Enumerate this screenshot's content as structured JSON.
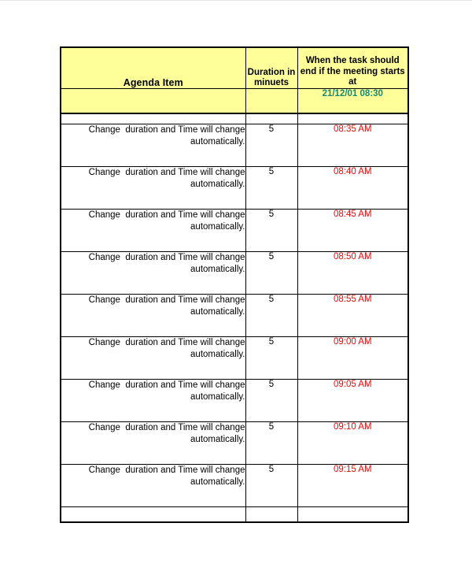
{
  "document": {
    "type": "meeting-agenda-table",
    "background_color": "#ffffff"
  },
  "table": {
    "header_background": "#ffff99",
    "border_color": "#000000",
    "columns": [
      {
        "key": "agenda_item",
        "label": "Agenda Item"
      },
      {
        "key": "duration",
        "label": "Duration\nin minuets"
      },
      {
        "key": "end_time",
        "label": "When the task should\nend if the meeting\nstarts at"
      }
    ],
    "start_datetime": {
      "value": "21/12/01  08:30",
      "color": "#138a72"
    },
    "time_color": "#ff0000",
    "rows": [
      {
        "agenda_item": "Change  duration and Time will change automatically.",
        "duration": "5",
        "end_time": "08:35 AM"
      },
      {
        "agenda_item": "Change  duration and Time will change automatically.",
        "duration": "5",
        "end_time": "08:40 AM"
      },
      {
        "agenda_item": "Change  duration and Time will change automatically.",
        "duration": "5",
        "end_time": "08:45 AM"
      },
      {
        "agenda_item": "Change  duration and Time will change automatically.",
        "duration": "5",
        "end_time": "08:50 AM"
      },
      {
        "agenda_item": "Change  duration and Time will change automatically.",
        "duration": "5",
        "end_time": "08:55 AM"
      },
      {
        "agenda_item": "Change  duration and Time will change automatically.",
        "duration": "5",
        "end_time": "09:00 AM"
      },
      {
        "agenda_item": "Change  duration and Time will change automatically.",
        "duration": "5",
        "end_time": "09:05 AM"
      },
      {
        "agenda_item": "Change  duration and Time will change automatically.",
        "duration": "5",
        "end_time": "09:10 AM"
      },
      {
        "agenda_item": "Change  duration and Time will change automatically.",
        "duration": "5",
        "end_time": "09:15 AM"
      }
    ]
  }
}
